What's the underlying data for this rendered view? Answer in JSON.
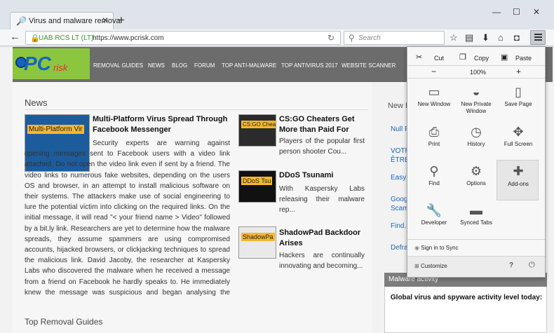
{
  "tab": {
    "title": "Virus and malware removal",
    "close": "✕",
    "new_tab": "+"
  },
  "window": {
    "minimize": "—",
    "maximize": "☐",
    "close": "✕"
  },
  "nav": {
    "back": "←",
    "identity": "UAB RCS LT (LT)",
    "url": "https://www.pcrisk.com",
    "reload": "↻",
    "search_placeholder": "Search"
  },
  "site": {
    "logo_pc": "PC",
    "logo_risk": "risk",
    "menu": [
      "REMOVAL GUIDES",
      "NEWS",
      "BLOG",
      "FORUM",
      "TOP ANTI-MALWARE",
      "TOP ANTIVIRUS 2017",
      "WEBSITE SCANNER"
    ]
  },
  "news": {
    "heading": "News",
    "main": {
      "thumb_label": "Multi-Platform Vir",
      "title": "Multi-Platform Virus Spread Through Facebook Messenger",
      "body": "Security experts are warning against opening messages sent to Facebook users with a video link attached. Do not open the video link even if sent by a friend. The video links to numerous fake websites, depending on the users OS and browser, in an attempt to install malicious software on their systems. The attackers make use of social engineering to lure the potential victim into clicking on the required links. On the initial message, it will read \"< your friend name > Video\" followed by a bit.ly link. Researchers are yet to determine how the malware spreads, they assume spammers are using compromised accounts, hijacked browsers, or clickjacking techniques to spread the malicious link. David Jacoby, the researcher at Kaspersky Labs who discovered the malware when he received a message from a friend on Facebook he hardly speaks to. He immediately knew the message was suspicious and began analysing the message. In a..."
    },
    "side_articles": [
      {
        "thumb_label": "CS:GO Cheaters",
        "title": "CS:GO Cheaters Get More than Paid For",
        "body": "Players of the popular first person shooter Cou..."
      },
      {
        "thumb_label": "DDoS Tsu",
        "title": "DDoS Tsunami",
        "body": "With Kaspersky Labs releasing their malware rep..."
      },
      {
        "thumb_label": "ShadowPa",
        "title": "ShadowPad Backdoor Arises",
        "body": "Hackers are continually innovating and becoming..."
      }
    ],
    "top_removal": "Top Removal Guides"
  },
  "sidebar": {
    "heading": "New R",
    "links": [
      "Null F",
      "VOTR ÊTRE",
      "EasyE",
      "Goog Scam",
      "Find.n",
      "Defra"
    ],
    "malware_heading": "Malware activity",
    "malware_sub": "Global virus and spyware activity level today:"
  },
  "menu_panel": {
    "cut": "Cut",
    "copy": "Copy",
    "paste": "Paste",
    "zoom_out": "−",
    "zoom": "100%",
    "zoom_in": "+",
    "items": [
      {
        "label": "New Window",
        "icon": "▭"
      },
      {
        "label": "New Private Window",
        "icon": "◒"
      },
      {
        "label": "Save Page",
        "icon": "▯"
      },
      {
        "label": "Print",
        "icon": "⎙"
      },
      {
        "label": "History",
        "icon": "◷"
      },
      {
        "label": "Full Screen",
        "icon": "✥"
      },
      {
        "label": "Find",
        "icon": "⚲"
      },
      {
        "label": "Options",
        "icon": "⚙"
      },
      {
        "label": "Add-ons",
        "icon": "✚"
      },
      {
        "label": "Developer",
        "icon": "🔧"
      },
      {
        "label": "Synced Tabs",
        "icon": "▬"
      }
    ],
    "sign_in": "Sign in to Sync",
    "customize": "Customize",
    "help": "?",
    "quit": "⏻"
  }
}
